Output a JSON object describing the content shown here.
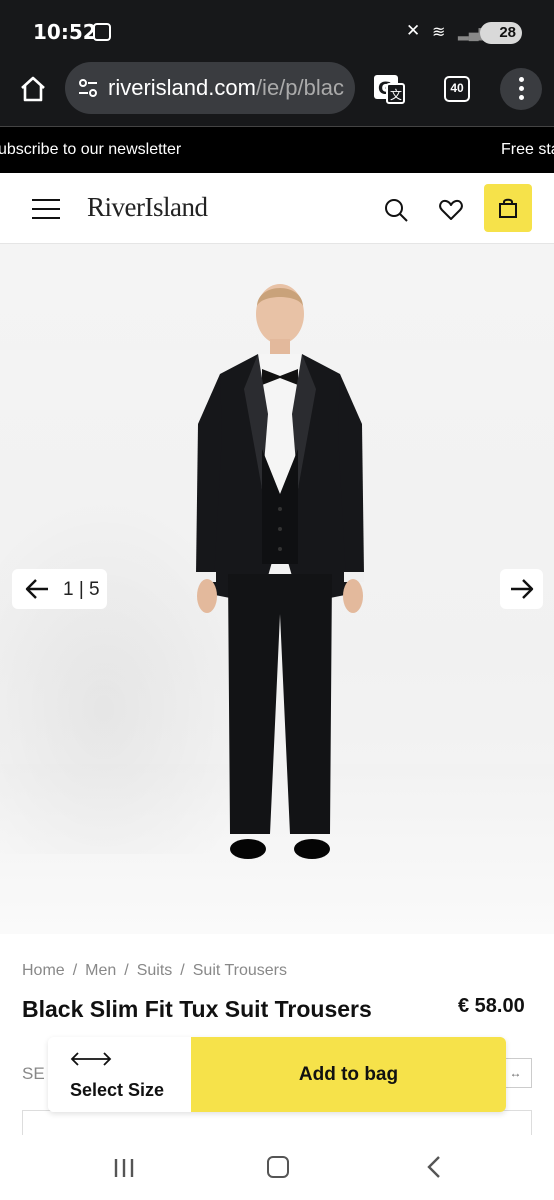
{
  "status_bar": {
    "time": "10:52",
    "battery": "28"
  },
  "browser": {
    "url_main": "riverisland.com",
    "url_path": "/ie/p/blac",
    "tab_count": "40"
  },
  "promo": {
    "left": "ubscribe to our newsletter",
    "right": "Free sta"
  },
  "header": {
    "logo": "RiverIsland"
  },
  "gallery": {
    "counter": "1 | 5"
  },
  "breadcrumb": [
    "Home",
    "Men",
    "Suits",
    "Suit Trousers"
  ],
  "product": {
    "title": "Black Slim Fit Tux Suit Trousers",
    "price": "€ 58.00"
  },
  "size_section": {
    "label_partial": "SE"
  },
  "sticky_bar": {
    "select_size": "Select Size",
    "add_to_bag": "Add to bag"
  },
  "colors": {
    "accent_yellow": "#f6e24a",
    "chrome_dark": "#17181a"
  }
}
